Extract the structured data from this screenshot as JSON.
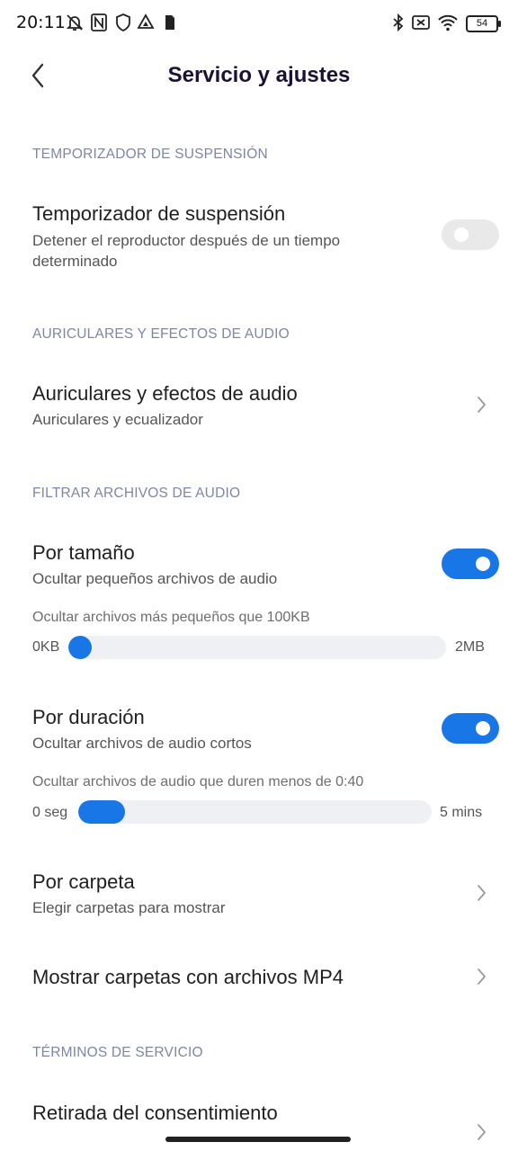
{
  "status_bar": {
    "time": "20:11",
    "battery": "54",
    "icons": [
      "mute-icon",
      "nfc-icon",
      "shield-icon",
      "drive-icon",
      "sim-icon",
      "bluetooth-icon",
      "no-sim-icon",
      "wifi-icon"
    ]
  },
  "header": {
    "title": "Servicio y ajustes",
    "back_icon": "chevron-left-icon"
  },
  "sections": {
    "sleep": {
      "heading": "TEMPORIZADOR DE SUSPENSIÓN"
    },
    "audio": {
      "heading": "AURICULARES Y EFECTOS DE AUDIO"
    },
    "filter": {
      "heading": "FILTRAR ARCHIVOS DE AUDIO"
    },
    "terms": {
      "heading": "TÉRMINOS DE SERVICIO"
    }
  },
  "sleep_timer": {
    "title": "Temporizador de suspensión",
    "subtitle_line1": "Detener el reproductor después de un tiempo",
    "subtitle_line2": "determinado",
    "enabled": false
  },
  "audio_effects": {
    "title": "Auriculares y efectos de audio",
    "subtitle": "Auriculares y ecualizador"
  },
  "by_size": {
    "title": "Por tamaño",
    "subtitle": "Ocultar pequeños archivos de audio",
    "enabled": true,
    "slider_caption": "Ocultar archivos más pequeños que 100KB",
    "min_label": "0KB",
    "max_label": "2MB",
    "value_fraction": 0.05
  },
  "by_duration": {
    "title": "Por duración",
    "subtitle": "Ocultar archivos de audio cortos",
    "enabled": true,
    "slider_caption": "Ocultar archivos de audio que duren menos de 0:40",
    "min_label": "0 seg",
    "max_label": "5 mins",
    "value_fraction": 0.133
  },
  "by_folder": {
    "title": "Por carpeta",
    "subtitle": "Elegir carpetas para mostrar"
  },
  "show_mp4": {
    "title": "Mostrar carpetas con archivos MP4"
  },
  "consent": {
    "title": "Retirada del consentimiento"
  },
  "colors": {
    "accent": "#1976e6",
    "section_heading": "#7d86a6",
    "title": "#1b1133"
  }
}
